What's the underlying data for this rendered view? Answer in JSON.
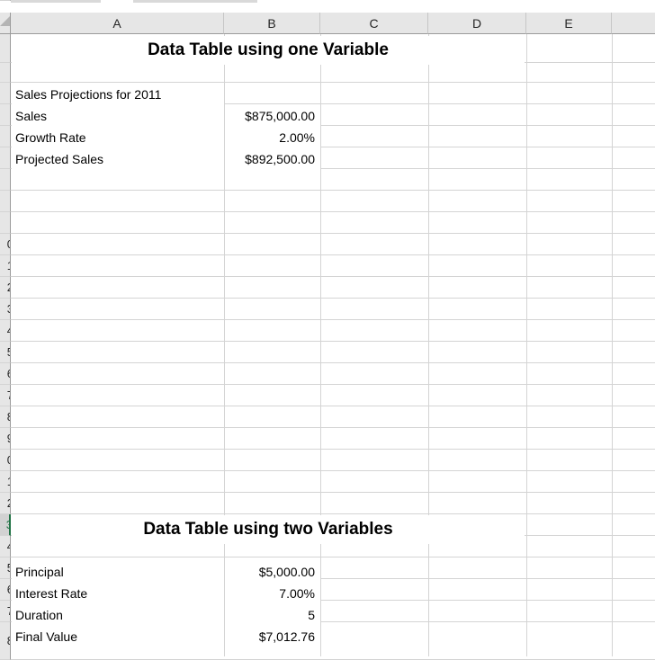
{
  "columns": [
    "A",
    "B",
    "C",
    "D",
    "E"
  ],
  "rows": [
    "",
    "",
    "",
    "",
    "",
    "",
    "",
    "",
    "",
    "0",
    "1",
    "2",
    "3",
    "4",
    "5",
    "6",
    "7",
    "8",
    "9",
    "0",
    "1",
    "2",
    "3",
    "4",
    "5",
    "6",
    "7",
    "8",
    ""
  ],
  "table_one": {
    "title": "Data Table using one Variable",
    "heading": "Sales Projections for 2011",
    "items": [
      {
        "label": "Sales",
        "value": "$875,000.00"
      },
      {
        "label": "Growth Rate",
        "value": "2.00%"
      },
      {
        "label": "Projected Sales",
        "value": "$892,500.00"
      }
    ]
  },
  "table_two": {
    "title": "Data Table using two Variables",
    "items": [
      {
        "label": "Principal",
        "value": "$5,000.00"
      },
      {
        "label": "Interest Rate",
        "value": "7.00%"
      },
      {
        "label": "Duration",
        "value": "5"
      },
      {
        "label": "Final Value",
        "value": "$7,012.76"
      }
    ]
  },
  "colors": {
    "header_bg": "#e6e6e6",
    "gridline": "#d4d4d4",
    "selection_accent": "#217346"
  }
}
